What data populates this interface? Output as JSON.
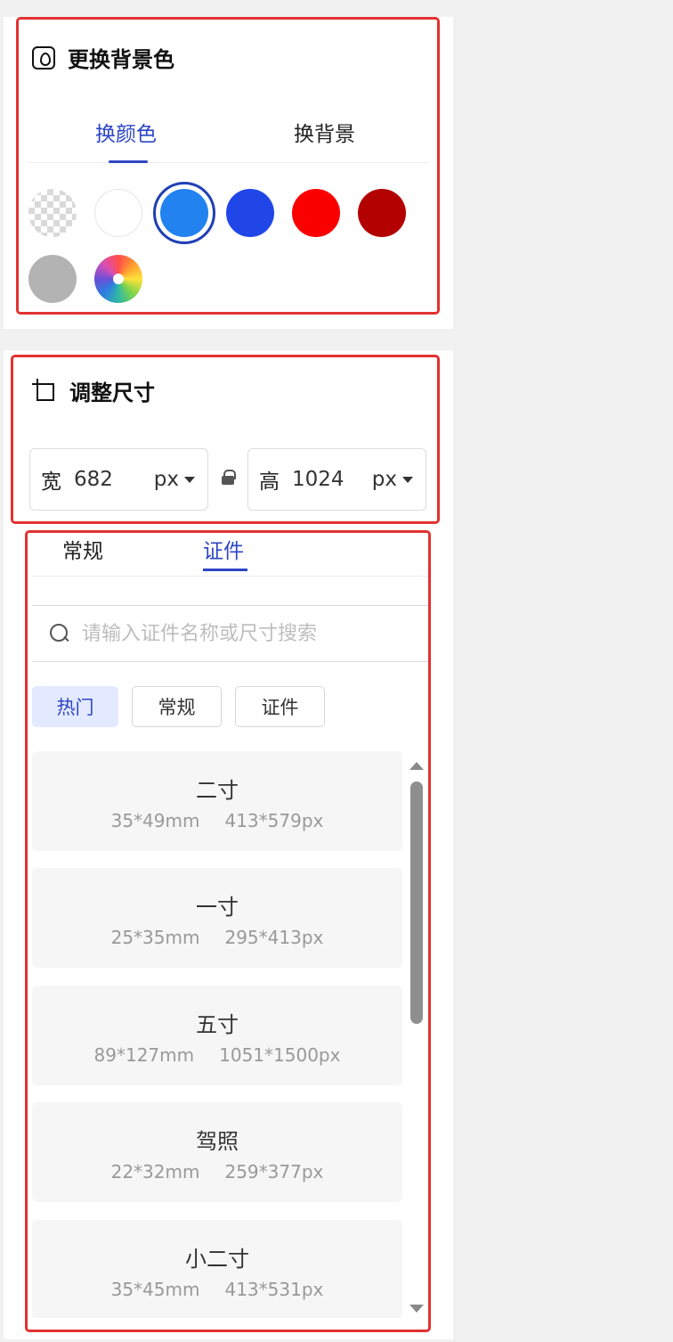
{
  "bg_section": {
    "title": "更换背景色",
    "tabs": [
      {
        "label": "换颜色",
        "active": true
      },
      {
        "label": "换背景",
        "active": false
      }
    ],
    "swatches": [
      {
        "name": "transparent",
        "color": "transparent"
      },
      {
        "name": "white",
        "color": "#ffffff"
      },
      {
        "name": "light-blue",
        "color": "#2182f0",
        "selected": true
      },
      {
        "name": "blue",
        "color": "#2046e8"
      },
      {
        "name": "red",
        "color": "#fb0000"
      },
      {
        "name": "dark-red",
        "color": "#b30000"
      },
      {
        "name": "gray",
        "color": "#b3b3b3"
      },
      {
        "name": "custom-color",
        "color": "color-wheel"
      }
    ]
  },
  "size_section": {
    "title": "调整尺寸",
    "width": {
      "label": "宽",
      "value": "682",
      "unit": "px"
    },
    "height": {
      "label": "高",
      "value": "1024",
      "unit": "px"
    },
    "tabs": [
      {
        "label": "常规",
        "active": false
      },
      {
        "label": "证件",
        "active": true
      }
    ],
    "search": {
      "placeholder": "请输入证件名称或尺寸搜索",
      "value": ""
    },
    "chips": [
      {
        "label": "热门",
        "active": true
      },
      {
        "label": "常规",
        "active": false
      },
      {
        "label": "证件",
        "active": false
      }
    ],
    "sizes": [
      {
        "name": "二寸",
        "mm": "35*49mm",
        "px": "413*579px"
      },
      {
        "name": "一寸",
        "mm": "25*35mm",
        "px": "295*413px"
      },
      {
        "name": "五寸",
        "mm": "89*127mm",
        "px": "1051*1500px"
      },
      {
        "name": "驾照",
        "mm": "22*32mm",
        "px": "259*377px"
      },
      {
        "name": "小二寸",
        "mm": "35*45mm",
        "px": "413*531px"
      }
    ]
  },
  "colors": {
    "accent": "#2d45c5",
    "highlight_border": "#e23232",
    "chip_active_bg": "#e3e9ff"
  }
}
